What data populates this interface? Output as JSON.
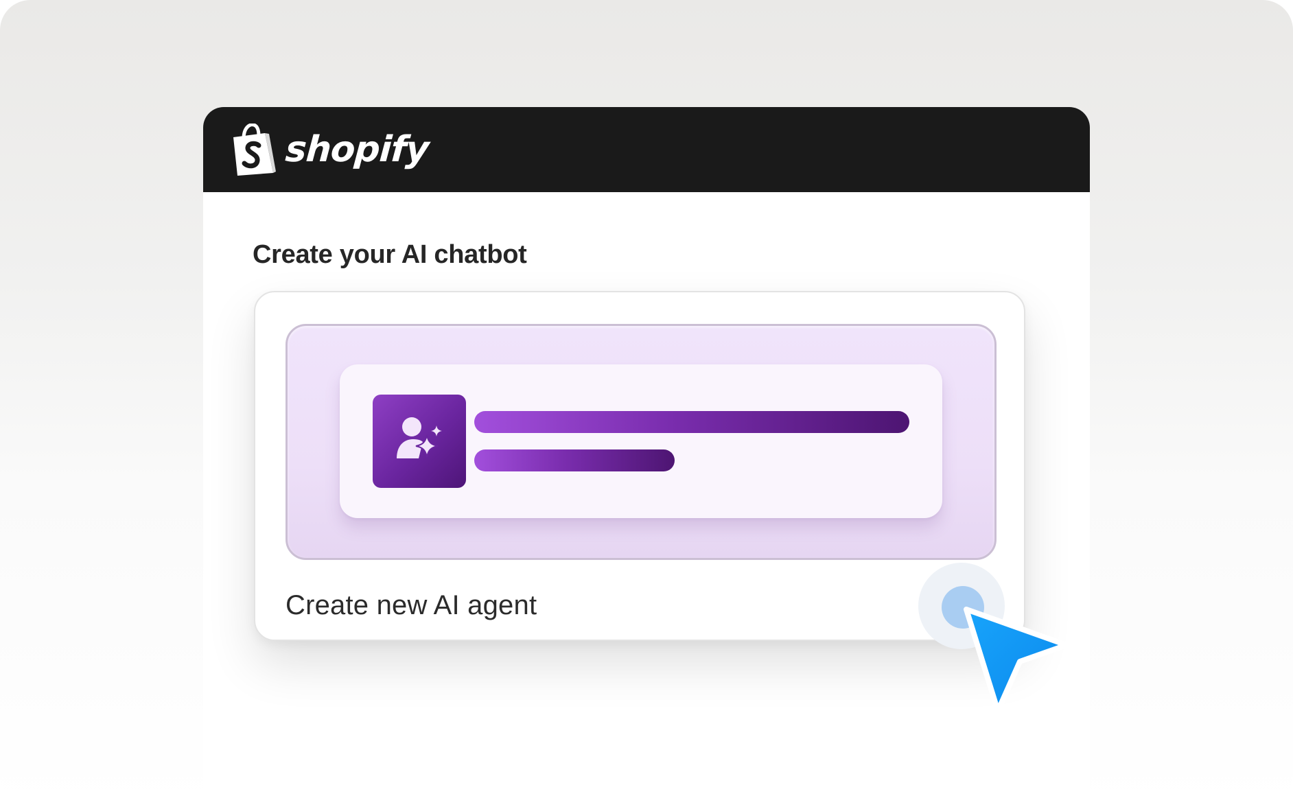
{
  "app": {
    "brand": "shopify",
    "logo_icon": "shopify-bag-icon"
  },
  "main": {
    "heading": "Create your AI chatbot"
  },
  "option": {
    "label": "Create new AI agent",
    "selected": true,
    "preview_icon": "ai-agent-icon",
    "radio_icon": "radio-button-icon"
  },
  "cursor": {
    "icon": "pointer-cursor-icon"
  },
  "colors": {
    "titlebar": "#1a1a1a",
    "accent_purple": "#6a259f",
    "preview_bg": "#f0e4fb",
    "radio_blue": "#a9cdf2",
    "cursor_blue": "#0f95f2"
  }
}
